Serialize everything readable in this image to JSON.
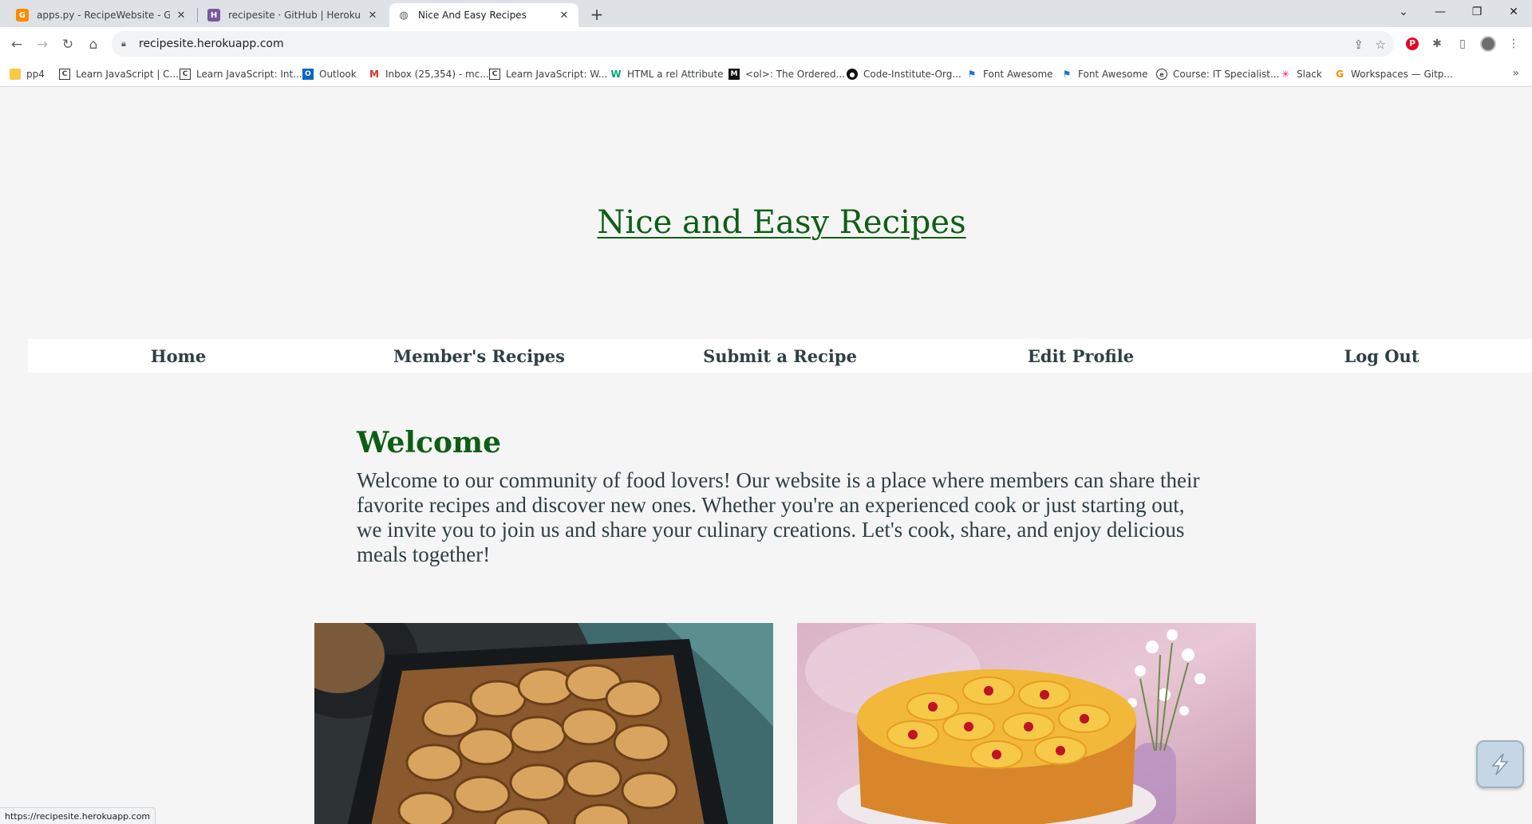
{
  "browser": {
    "tabs": [
      {
        "title": "apps.py - RecipeWebsite - Gitpod",
        "favicon": "gitpod-icon",
        "color": "#ff8a00"
      },
      {
        "title": "recipesite · GitHub | Heroku",
        "favicon": "heroku-icon",
        "color": "#79589f"
      },
      {
        "title": "Nice And Easy Recipes",
        "favicon": "globe-icon",
        "color": "#5f6368"
      }
    ],
    "url": "recipesite.herokuapp.com",
    "bookmarks": [
      {
        "label": "pp4",
        "icon": "folder-icon"
      },
      {
        "label": "Learn JavaScript | C...",
        "icon": "codecademy-icon"
      },
      {
        "label": "Learn JavaScript: Int...",
        "icon": "codecademy-icon"
      },
      {
        "label": "Outlook",
        "icon": "outlook-icon"
      },
      {
        "label": "Inbox (25,354) - mc...",
        "icon": "gmail-icon"
      },
      {
        "label": "Learn JavaScript: W...",
        "icon": "codecademy-icon"
      },
      {
        "label": "HTML a rel Attribute",
        "icon": "w3schools-icon"
      },
      {
        "label": "<ol>: The Ordered...",
        "icon": "mdn-icon"
      },
      {
        "label": "Code-Institute-Org...",
        "icon": "github-icon"
      },
      {
        "label": "Font Awesome",
        "icon": "flag-icon"
      },
      {
        "label": "Font Awesome",
        "icon": "flag-icon"
      },
      {
        "label": "Course: IT Specialist...",
        "icon": "course-icon"
      },
      {
        "label": "Slack",
        "icon": "slack-icon"
      },
      {
        "label": "Workspaces — Gitp...",
        "icon": "gitpod-icon"
      }
    ],
    "status_url": "https://recipesite.herokuapp.com"
  },
  "site": {
    "title": "Nice and Easy Recipes",
    "nav": [
      "Home",
      "Member's Recipes",
      "Submit a Recipe",
      "Edit Profile",
      "Log Out"
    ],
    "welcome_title": "Welcome",
    "welcome_text": "Welcome to our community of food lovers! Our website is a place where members can share their favorite recipes and discover new ones. Whether you're an experienced cook or just starting out, we invite you to join us and share your culinary creations. Let's cook, share, and enjoy delicious meals together!",
    "accent_color": "#0d5e14",
    "cards": [
      {
        "image": "potato-bake-image"
      },
      {
        "image": "pineapple-cake-image"
      }
    ]
  }
}
